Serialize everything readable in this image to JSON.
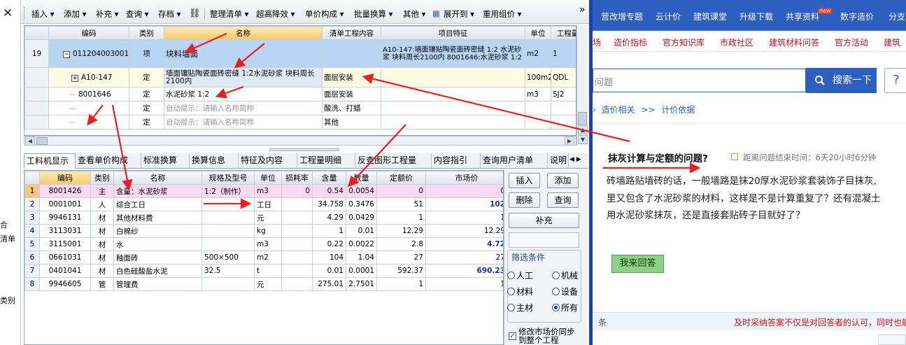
{
  "left_strip": {
    "close": "✕",
    "t1": "合",
    "t2": "清单",
    "t3": "类别"
  },
  "toolbar": {
    "items": [
      "插入",
      "添加",
      "补充",
      "查询",
      "存档",
      "整理清单",
      "超高降效",
      "单价构成",
      "批量换算",
      "其他",
      "展开到",
      "重用组价"
    ],
    "more": "»"
  },
  "top_grid": {
    "headers": [
      "编码",
      "类别",
      "名称",
      "清单工程内容",
      "项目特征",
      "单位",
      "工程量"
    ],
    "rows": [
      {
        "rownum": "19",
        "expand": "−",
        "code": "011204003001",
        "type": "项",
        "name": "块料墙面",
        "content": "",
        "feature": "A10-147:墙面镶贴陶瓷面砖密缝 1:2 水泥砂浆 块料周长2100内 8001646:水泥砂浆 1:2",
        "unit": "m2",
        "qty": "1"
      },
      {
        "rownum": "",
        "expand": "+",
        "code": "A10-147",
        "type": "定",
        "name": "墙面镶贴陶瓷面砖密缝 1:2水泥砂浆 块料周长2100内",
        "content": "面层安装",
        "feature": "",
        "unit": "100m2",
        "qty": "QDL"
      },
      {
        "rownum": "",
        "expand": "",
        "code": "8001646",
        "type": "定",
        "name": "水泥砂浆 1:2",
        "content": "面层安装",
        "feature": "",
        "unit": "m3",
        "qty": "SJ2"
      },
      {
        "rownum": "",
        "expand": "",
        "code": "",
        "type": "定",
        "name": "自动提示：请输入名称简称",
        "content": "酸洗、打蜡",
        "feature": "",
        "unit": "",
        "qty": ""
      },
      {
        "rownum": "",
        "expand": "",
        "code": "",
        "type": "定",
        "name": "自动提示：请输入名称简称",
        "content": "其他",
        "feature": "",
        "unit": "",
        "qty": ""
      }
    ]
  },
  "tabs": [
    "工料机显示",
    "查看单价构成",
    "标准换算",
    "换算信息",
    "特征及内容",
    "工程量明细",
    "反查图形工程量",
    "内容指引",
    "查询用户清单",
    "说明"
  ],
  "bottom_grid": {
    "headers": [
      "",
      "编码",
      "类别",
      "名称",
      "规格及型号",
      "单位",
      "损耗率",
      "含量",
      "数量",
      "定额价",
      "市场价"
    ],
    "rows": [
      [
        "1",
        "8001426",
        "主",
        "含量：水泥砂浆",
        "1:2（制作）",
        "m3",
        "0",
        "0.54",
        "0.0054",
        "0",
        "0"
      ],
      [
        "2",
        "0001001",
        "人",
        "综合工日",
        "",
        "工日",
        "",
        "34.758",
        "0.3476",
        "51",
        "102"
      ],
      [
        "3",
        "9946131",
        "材",
        "其他材料费",
        "",
        "元",
        "",
        "4.29",
        "0.0429",
        "1",
        "1"
      ],
      [
        "4",
        "3113031",
        "材",
        "白棉纱",
        "",
        "kg",
        "",
        "1",
        "0.01",
        "12.29",
        "12.29"
      ],
      [
        "5",
        "3115001",
        "材",
        "水",
        "",
        "m3",
        "",
        "0.22",
        "0.0022",
        "2.8",
        "4.72"
      ],
      [
        "6",
        "0661031",
        "材",
        "釉面砖",
        "500×500",
        "m2",
        "",
        "104",
        "1.04",
        "27",
        "27"
      ],
      [
        "7",
        "0401041",
        "材",
        "白色硅酸盐水泥",
        "32.5",
        "t",
        "",
        "0.01",
        "0.0001",
        "592.37",
        "690.23"
      ],
      [
        "8",
        "9946605",
        "管",
        "管理费",
        "",
        "元",
        "",
        "275.01",
        "2.7501",
        "1",
        "1"
      ]
    ]
  },
  "side_panel": {
    "insert": "插入",
    "add": "添加",
    "delete": "删除",
    "query": "查询",
    "supplement": "补充",
    "filter_title": "筛选条件",
    "radios": [
      "人工",
      "机械",
      "材料",
      "设备",
      "主材",
      "所有"
    ],
    "checkbox_label": "修改市场价同步到整个工程"
  },
  "web": {
    "nav1": [
      "营改增专题",
      "云计价",
      "建筑课堂",
      "升级下载",
      "共享资料",
      "数字造价",
      "分支"
    ],
    "new_badge": "new",
    "nav2": [
      "场",
      "造价指标",
      "官方知识库",
      "市政社区",
      "建筑材料问答",
      "官方活动",
      "建筑"
    ],
    "search_placeholder": "问题",
    "search_button": "搜索一下",
    "help_btn": "?",
    "crumb": [
      "造价相关",
      ">>",
      "计价依据"
    ],
    "question_title": "抹灰计算与定额的问题?",
    "deadline": "距离问题结束时间：6天20小时6分钟",
    "body_lines": [
      "砖墙路贴墙砖的话，一般墙路是抹20厚水泥砂浆套装饰子目抹灰,",
      "里又包含了水泥砂浆的材料，这样是不是计算重复了？还有混凝土",
      "用水泥砂浆抹灰，还是直接套贴砖子目就好了？"
    ],
    "answer_button": "我来回答",
    "footer_left": "条",
    "footer_right": "及时采纳答案不仅是对回答者的认可，同时也能"
  }
}
